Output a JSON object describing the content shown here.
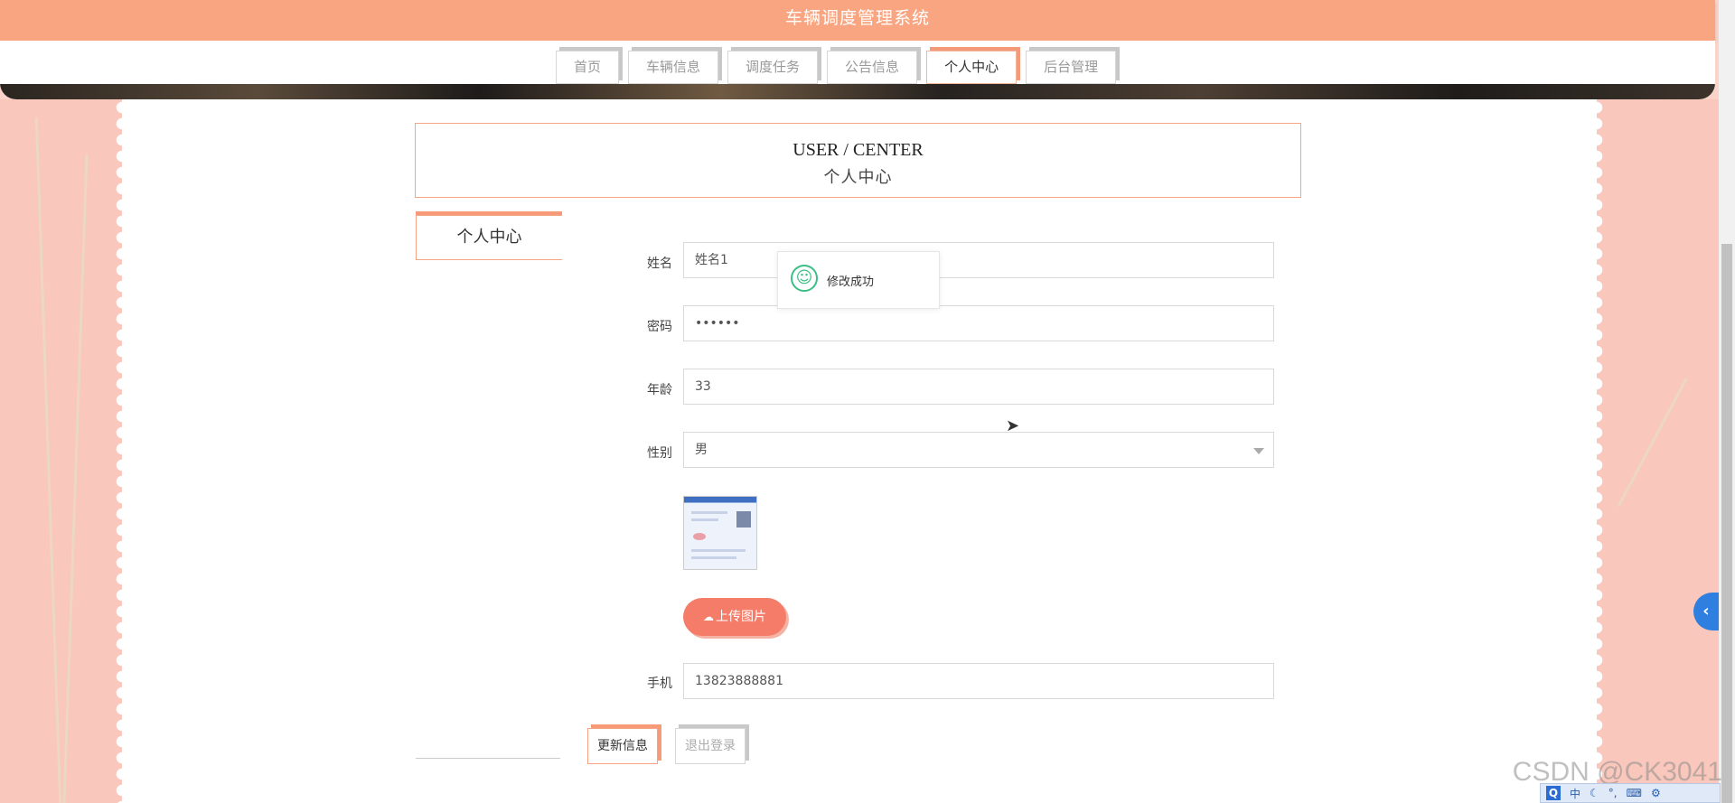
{
  "app": {
    "title": "车辆调度管理系统"
  },
  "nav": [
    {
      "label": "首页",
      "active": false
    },
    {
      "label": "车辆信息",
      "active": false
    },
    {
      "label": "调度任务",
      "active": false
    },
    {
      "label": "公告信息",
      "active": false
    },
    {
      "label": "个人中心",
      "active": true
    },
    {
      "label": "后台管理",
      "active": false
    }
  ],
  "page_header": {
    "en": "USER / CENTER",
    "zh": "个人中心"
  },
  "sidebar": {
    "item": "个人中心"
  },
  "form": {
    "name_label": "姓名",
    "name_value": "姓名1",
    "password_label": "密码",
    "password_value": "••••••",
    "age_label": "年龄",
    "age_value": "33",
    "gender_label": "性别",
    "gender_value": "男",
    "upload_label": "上传图片",
    "phone_label": "手机",
    "phone_value": "13823888881"
  },
  "buttons": {
    "update": "更新信息",
    "logout": "退出登录"
  },
  "toast": {
    "message": "修改成功"
  },
  "watermark": "CSDN @CK3041",
  "ime": {
    "q": "Q",
    "lang": "中"
  },
  "colors": {
    "header": "#f9a581",
    "accent": "#f47c68",
    "success": "#3cbf85"
  }
}
